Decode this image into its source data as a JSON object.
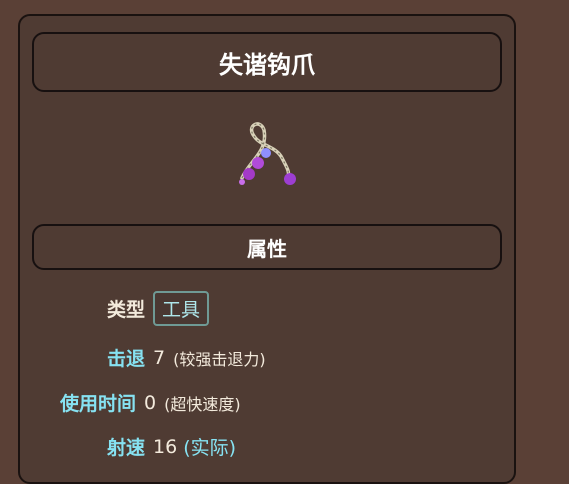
{
  "item": {
    "name": "失谐钩爪",
    "icon": "grappling-hook-icon"
  },
  "section": {
    "title": "属性"
  },
  "stats": {
    "type_label": "类型",
    "type_value": "工具",
    "knockback_label": "击退",
    "knockback_value": "7",
    "knockback_note": "(较强击退力)",
    "use_time_label": "使用时间",
    "use_time_value": "0",
    "use_time_note": "(超快速度)",
    "velocity_label": "射速",
    "velocity_value": "16",
    "velocity_note": "(实际)"
  },
  "colors": {
    "background": "#5a4036",
    "panel": "#4f3b33",
    "label": "#86e2f2",
    "text": "#f3eadc"
  }
}
